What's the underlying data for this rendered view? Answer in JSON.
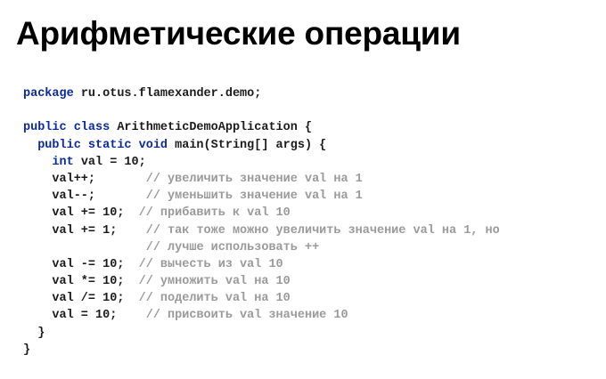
{
  "title": "Арифметические операции",
  "code_lines": [
    [
      {
        "t": "kw",
        "v": "package"
      },
      {
        "t": "plain",
        "v": " ru.otus.flamexander.demo;"
      }
    ],
    [],
    [
      {
        "t": "kw",
        "v": "public class"
      },
      {
        "t": "plain",
        "v": " ArithmeticDemoApplication {"
      }
    ],
    [
      {
        "t": "plain",
        "v": "  "
      },
      {
        "t": "kw",
        "v": "public static void"
      },
      {
        "t": "plain",
        "v": " main(String[] args) {"
      }
    ],
    [
      {
        "t": "plain",
        "v": "    "
      },
      {
        "t": "kw",
        "v": "int"
      },
      {
        "t": "plain",
        "v": " val = 10;"
      }
    ],
    [
      {
        "t": "plain",
        "v": "    val++;       "
      },
      {
        "t": "cm",
        "v": "// увеличить значение val на 1"
      }
    ],
    [
      {
        "t": "plain",
        "v": "    val--;       "
      },
      {
        "t": "cm",
        "v": "// уменьшить значение val на 1"
      }
    ],
    [
      {
        "t": "plain",
        "v": "    val += 10;  "
      },
      {
        "t": "cm",
        "v": "// прибавить к val 10"
      }
    ],
    [
      {
        "t": "plain",
        "v": "    val += 1;    "
      },
      {
        "t": "cm",
        "v": "// так тоже можно увеличить значение val на 1, но"
      }
    ],
    [
      {
        "t": "plain",
        "v": "                 "
      },
      {
        "t": "cm",
        "v": "// лучше использовать ++"
      }
    ],
    [
      {
        "t": "plain",
        "v": "    val -= 10;  "
      },
      {
        "t": "cm",
        "v": "// вычесть из val 10"
      }
    ],
    [
      {
        "t": "plain",
        "v": "    val *= 10;  "
      },
      {
        "t": "cm",
        "v": "// умножить val на 10"
      }
    ],
    [
      {
        "t": "plain",
        "v": "    val /= 10;  "
      },
      {
        "t": "cm",
        "v": "// поделить val на 10"
      }
    ],
    [
      {
        "t": "plain",
        "v": "    val = 10;    "
      },
      {
        "t": "cm",
        "v": "// присвоить val значение 10"
      }
    ],
    [
      {
        "t": "plain",
        "v": "  }"
      }
    ],
    [
      {
        "t": "plain",
        "v": "}"
      }
    ]
  ],
  "colors": {
    "keyword": "#0b2a9e",
    "code": "#1a1a1a",
    "comment": "#9a9a9a",
    "title": "#000000",
    "background": "#ffffff"
  }
}
